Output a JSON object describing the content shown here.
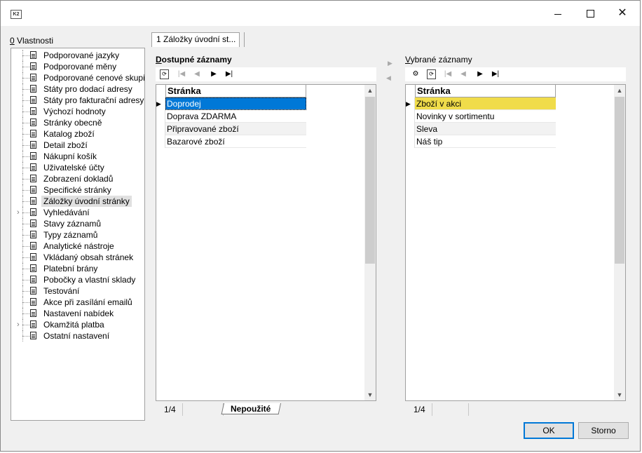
{
  "window": {
    "app_icon": "K2"
  },
  "tree": {
    "title": "Vlastnosti",
    "title_accel": "0",
    "items": [
      {
        "label": "Podporované jazyky"
      },
      {
        "label": "Podporované měny"
      },
      {
        "label": "Podporované cenové skupiny"
      },
      {
        "label": "Státy pro dodací adresy"
      },
      {
        "label": "Státy pro fakturační adresy"
      },
      {
        "label": "Výchozí hodnoty"
      },
      {
        "label": "Stránky obecně"
      },
      {
        "label": "Katalog zboží"
      },
      {
        "label": "Detail zboží"
      },
      {
        "label": "Nákupní košík"
      },
      {
        "label": "Uživatelské účty"
      },
      {
        "label": "Zobrazení dokladů"
      },
      {
        "label": "Specifické stránky"
      },
      {
        "label": "Záložky úvodní stránky"
      },
      {
        "label": "Vyhledávání"
      },
      {
        "label": "Stavy záznamů"
      },
      {
        "label": "Typy záznamů"
      },
      {
        "label": "Analytické nástroje"
      },
      {
        "label": "Vkládaný obsah stránek"
      },
      {
        "label": "Platební brány"
      },
      {
        "label": "Pobočky a vlastní sklady"
      },
      {
        "label": "Testování"
      },
      {
        "label": "Akce při zasílání emailů"
      },
      {
        "label": "Nastavení nabídek"
      },
      {
        "label": "Okamžitá platba"
      },
      {
        "label": "Ostatní nastavení"
      }
    ]
  },
  "tab": {
    "label": "1 Záložky úvodní st..."
  },
  "available": {
    "title_accel": "D",
    "title_rest": "ostupné záznamy",
    "column": "Stránka",
    "rows": [
      "Doprodej",
      "Doprava ZDARMA",
      "Připravované zboží",
      "Bazarové zboží"
    ],
    "status": "1/4",
    "bottom_tab": "Nepoužité"
  },
  "selected": {
    "title_accel": "V",
    "title_rest": "ybrané záznamy",
    "column": "Stránka",
    "rows": [
      "Zboží v akci",
      "Novinky v sortimentu",
      "Sleva",
      "Náš tip"
    ],
    "status": "1/4"
  },
  "buttons": {
    "ok": "OK",
    "cancel": "Storno"
  },
  "colors": {
    "selection_blue": "#0078d7",
    "selection_yellow": "#f0dc4a"
  }
}
